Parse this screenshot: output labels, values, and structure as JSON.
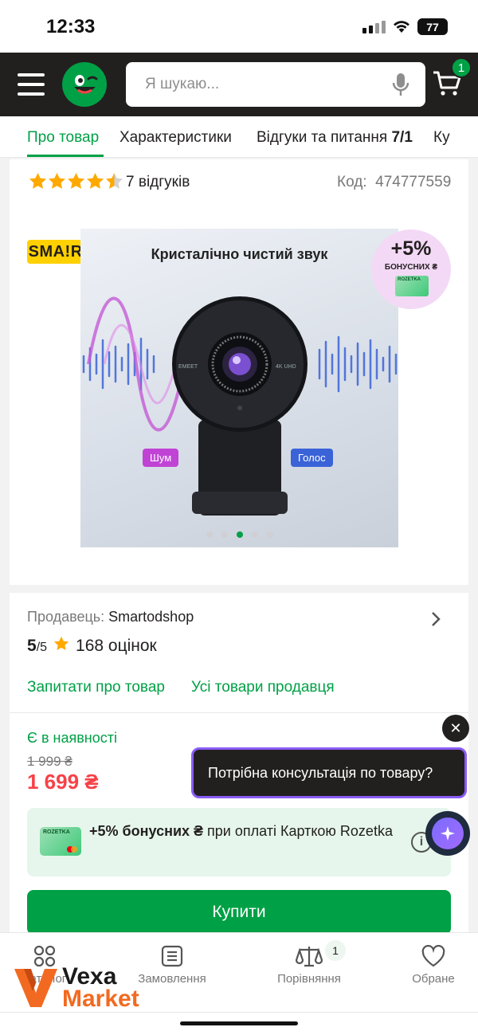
{
  "status_bar": {
    "time": "12:33",
    "battery": "77"
  },
  "header": {
    "search_placeholder": "Я шукаю...",
    "cart_count": "1"
  },
  "tabs": [
    {
      "label": "Про товар"
    },
    {
      "label": "Характеристики"
    },
    {
      "label": "Відгуки та питання",
      "count": "7/1"
    },
    {
      "label": "Ку"
    }
  ],
  "product": {
    "rating_stars": 4.5,
    "reviews": "7 відгуків",
    "code_label": "Код:",
    "code_value": "474777559",
    "smart_badge": "SMA!RT",
    "image_title": "Кристалічно чистий звук",
    "bonus_badge_pct": "+5%",
    "bonus_badge_text": "БОНУСНИХ ₴",
    "bonus_badge_card": "ROZETKA",
    "pill_noise": "Шум",
    "pill_voice": "Голос",
    "cam_brand_left": "EMEET",
    "cam_brand_right": "4K UHD",
    "gallery_dots": 5,
    "gallery_active": 3
  },
  "seller": {
    "label": "Продавець:",
    "name": "Smartodshop",
    "score": "5",
    "score_of": "/5",
    "ratings": "168 оцінок",
    "ask_link": "Запитати про товар",
    "all_link": "Усі товари продавця"
  },
  "pricing": {
    "availability": "Є в наявності",
    "old_price": "1 999 ₴",
    "price": "1 699 ₴",
    "bonus_bold": "+5% бонусних ₴",
    "bonus_rest": " при оплаті Карткою Rozetka",
    "card_label": "ROZETKA",
    "buy_label": "Купити"
  },
  "chat": {
    "bubble": "Потрібна консультація по товару?",
    "close": "✕"
  },
  "bottom_nav": [
    {
      "label": "Каталог",
      "icon": "grid-icon"
    },
    {
      "label": "Замовлення",
      "icon": "orders-icon"
    },
    {
      "label": "Порівняння",
      "icon": "scales-icon",
      "badge": "1"
    },
    {
      "label": "Обране",
      "icon": "heart-icon"
    }
  ],
  "watermark": {
    "line1": "Vexa",
    "line2": "Market"
  },
  "colors": {
    "brand_green": "#00a046",
    "header_dark": "#221f1f",
    "price_red": "#f84147",
    "star": "#ffa900"
  }
}
